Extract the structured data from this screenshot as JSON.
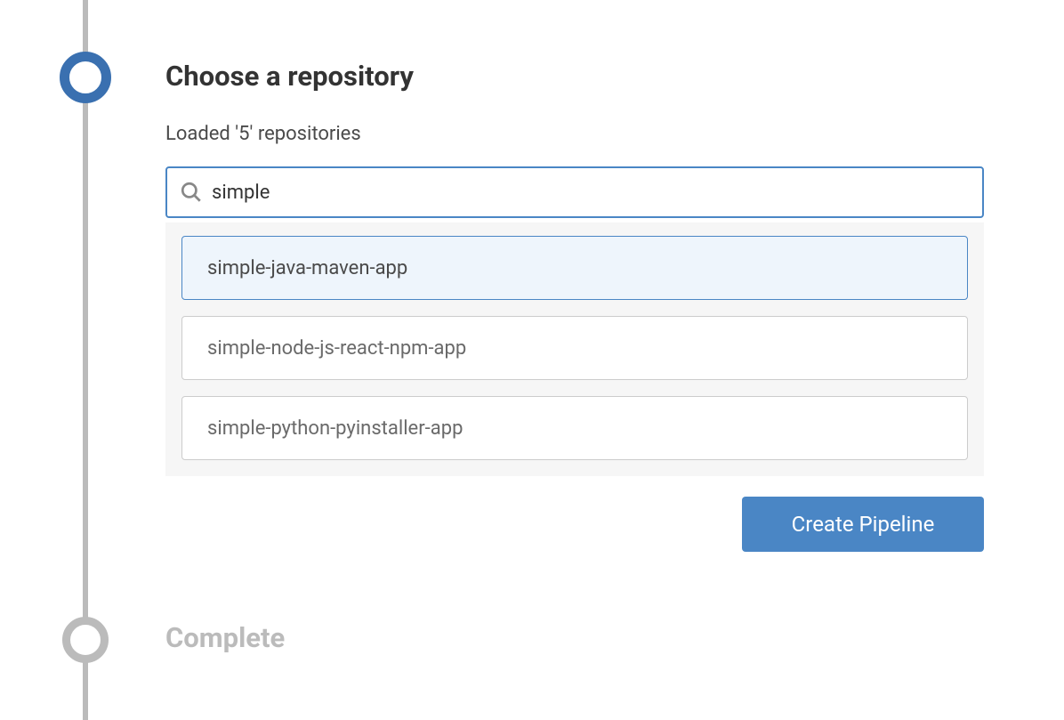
{
  "steps": {
    "choose": {
      "title": "Choose a repository",
      "loaded_text": "Loaded '5' repositories"
    },
    "complete": {
      "title": "Complete"
    }
  },
  "search": {
    "value": "simple",
    "placeholder": ""
  },
  "repositories": [
    {
      "name": "simple-java-maven-app",
      "selected": true
    },
    {
      "name": "simple-node-js-react-npm-app",
      "selected": false
    },
    {
      "name": "simple-python-pyinstaller-app",
      "selected": false
    }
  ],
  "buttons": {
    "create_pipeline": "Create Pipeline"
  }
}
